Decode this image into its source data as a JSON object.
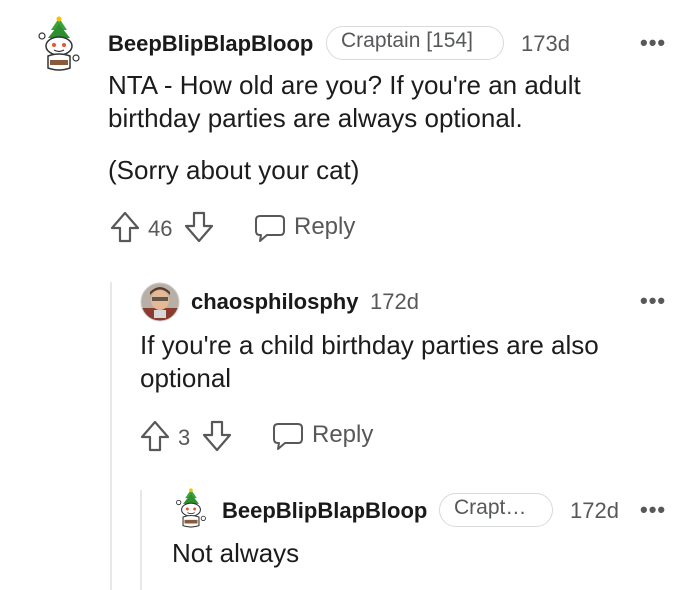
{
  "comments": [
    {
      "username": "BeepBlipBlapBloop",
      "flair": "Craptain [154]",
      "age": "173d",
      "paragraphs": [
        "NTA - How old are you? If you're an adult birthday parties are always optional.",
        "(Sorry about your cat)"
      ],
      "votes": "46",
      "reply_label": "Reply",
      "avatar_icon": "snoo-cake-avatar-icon"
    },
    {
      "username": "chaosphilosphy",
      "age": "172d",
      "paragraphs": [
        "If you're a child birthday parties are also optional"
      ],
      "votes": "3",
      "reply_label": "Reply",
      "avatar_icon": "user-photo-avatar-icon"
    },
    {
      "username": "BeepBlipBlapBloop",
      "flair": "Crapt…",
      "age": "172d",
      "paragraphs": [
        "Not always"
      ],
      "avatar_icon": "snoo-cake-avatar-icon"
    }
  ],
  "more_label": "•••",
  "colors": {
    "meta": "#57585a",
    "text": "#1c1c1c",
    "border": "#d7dadc",
    "thread": "#e6e8ea"
  }
}
